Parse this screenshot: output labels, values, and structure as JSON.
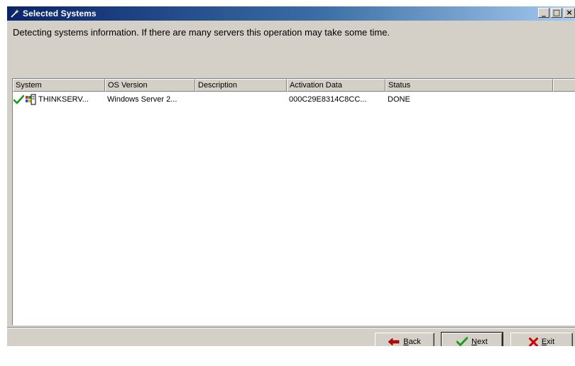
{
  "window": {
    "title": "Selected Systems",
    "title_icon": "wand-icon",
    "controls": {
      "minimize": "_",
      "maximize": "□",
      "close": "×"
    }
  },
  "message": "Detecting systems information. If there are many servers this operation may take some time.",
  "list": {
    "columns": [
      "System",
      "OS Version",
      "Description",
      "Activation Data",
      "Status"
    ],
    "rows": [
      {
        "status_icon": "checkmark-icon",
        "system_icon": "windows-server-icon",
        "system": "THINKSERV...",
        "os_version": "Windows Server 2...",
        "description": "",
        "activation_data": "000C29E8314C8CC...",
        "status": "DONE"
      }
    ]
  },
  "buttons": {
    "back": {
      "mnemonic": "B",
      "rest": "ack",
      "icon": "back-arrow-icon"
    },
    "next": {
      "mnemonic": "N",
      "rest": "ext",
      "icon": "checkmark-icon"
    },
    "exit": {
      "mnemonic": "E",
      "rest": "xit",
      "icon": "x-icon"
    }
  },
  "colors": {
    "title_start": "#0a246a",
    "title_end": "#a6caf0",
    "face": "#d4d0c8",
    "check_green": "#1a9a1a",
    "exit_red": "#cc0000",
    "back_red": "#cc0000"
  }
}
